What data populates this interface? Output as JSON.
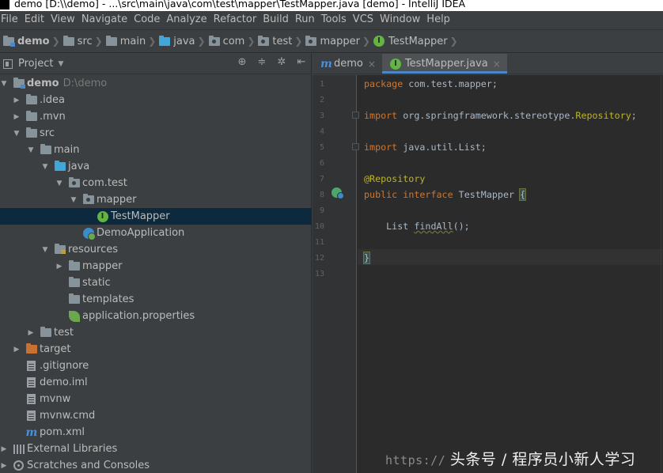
{
  "window": {
    "title": "demo [D:\\\\demo] - ...\\src\\main\\java\\com\\test\\mapper\\TestMapper.java [demo] - IntelliJ IDEA"
  },
  "menu": [
    "File",
    "Edit",
    "View",
    "Navigate",
    "Code",
    "Analyze",
    "Refactor",
    "Build",
    "Run",
    "Tools",
    "VCS",
    "Window",
    "Help"
  ],
  "breadcrumb": [
    "demo",
    "src",
    "main",
    "java",
    "com",
    "test",
    "mapper",
    "TestMapper"
  ],
  "project_panel": {
    "title": "Project",
    "tools": [
      "⊕",
      "≑",
      "✲",
      "⇤"
    ]
  },
  "tree": [
    {
      "label": "demo",
      "path": "D:\\demo",
      "icon": "module-folder-icon",
      "expanded": true
    },
    {
      "label": ".idea",
      "icon": "folder-icon",
      "expanded": false
    },
    {
      "label": ".mvn",
      "icon": "folder-icon",
      "expanded": false
    },
    {
      "label": "src",
      "icon": "folder-icon",
      "expanded": true
    },
    {
      "label": "main",
      "icon": "folder-icon",
      "expanded": true
    },
    {
      "label": "java",
      "icon": "source-folder-icon",
      "expanded": true
    },
    {
      "label": "com.test",
      "icon": "package-icon",
      "expanded": true
    },
    {
      "label": "mapper",
      "icon": "package-icon",
      "expanded": true
    },
    {
      "label": "TestMapper",
      "icon": "interface-icon",
      "selected": true
    },
    {
      "label": "DemoApplication",
      "icon": "spring-class-icon"
    },
    {
      "label": "resources",
      "icon": "resources-folder-icon",
      "expanded": true
    },
    {
      "label": "mapper",
      "icon": "folder-icon",
      "expanded": false
    },
    {
      "label": "static",
      "icon": "folder-icon"
    },
    {
      "label": "templates",
      "icon": "folder-icon"
    },
    {
      "label": "application.properties",
      "icon": "spring-properties-icon"
    },
    {
      "label": "test",
      "icon": "folder-icon",
      "expanded": false
    },
    {
      "label": "target",
      "icon": "excluded-folder-icon",
      "expanded": false
    },
    {
      "label": ".gitignore",
      "icon": "file-icon"
    },
    {
      "label": "demo.iml",
      "icon": "file-icon"
    },
    {
      "label": "mvnw",
      "icon": "file-icon"
    },
    {
      "label": "mvnw.cmd",
      "icon": "file-icon"
    },
    {
      "label": "pom.xml",
      "icon": "maven-icon"
    },
    {
      "label": "External Libraries",
      "icon": "libraries-icon",
      "expanded": false
    },
    {
      "label": "Scratches and Consoles",
      "icon": "scratches-icon",
      "expanded": false
    }
  ],
  "editor": {
    "tabs": [
      {
        "label": "demo",
        "icon": "maven-icon",
        "active": false
      },
      {
        "label": "TestMapper.java",
        "icon": "interface-icon",
        "active": true
      }
    ],
    "line_numbers": [
      "1",
      "2",
      "3",
      "4",
      "5",
      "6",
      "7",
      "8",
      "9",
      "10",
      "11",
      "12",
      "13"
    ],
    "code": {
      "l1_kw": "package",
      "l1_rest": " com.test.mapper;",
      "l3_kw": "import",
      "l3_rest": " org.springframework.stereotype.",
      "l3_ann": "Repository",
      "l3_end": ";",
      "l5_kw": "import",
      "l5_rest": " java.util.List;",
      "l7_ann": "@Repository",
      "l8_kw1": "public",
      "l8_kw2": "interface",
      "l8_name": " TestMapper ",
      "l8_brace": "{",
      "l10_type": "    List ",
      "l10_fn": "findAll",
      "l10_end": "();",
      "l12_brace": "}"
    }
  },
  "watermark": {
    "url": "https://",
    "text": "头条号 / 程序员小新人学习"
  },
  "colors": {
    "background": "#3c3f41",
    "editor_bg": "#2b2b2b",
    "keyword": "#cc7832",
    "annotation": "#bbb529",
    "selection": "#0d293e",
    "tab_accent": "#4a88c7"
  }
}
